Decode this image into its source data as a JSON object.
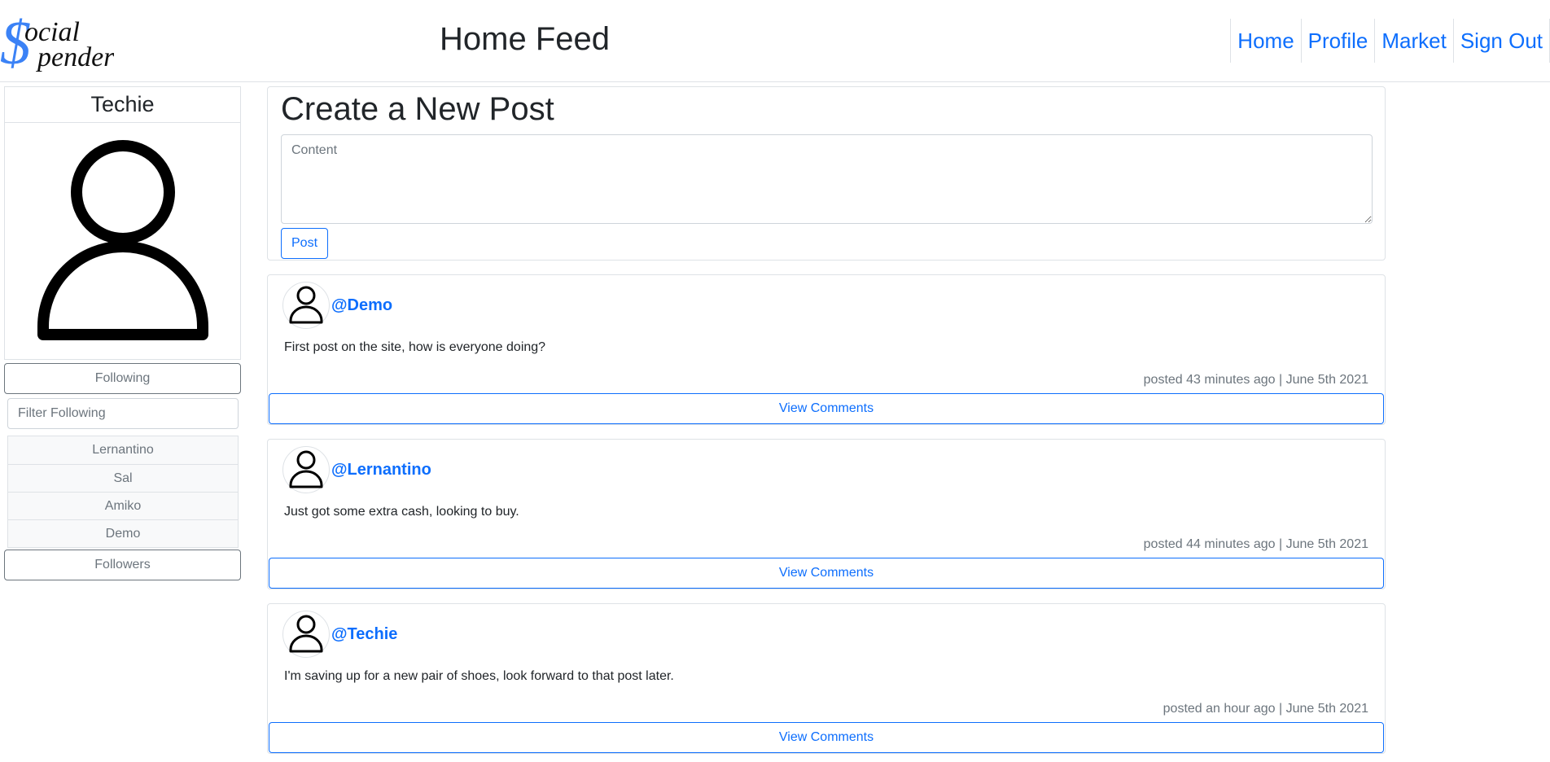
{
  "header": {
    "logo_text": "Social Spenders",
    "logo_line1": "ocial",
    "logo_line2": "penders",
    "title": "Home Feed",
    "nav": [
      "Home",
      "Profile",
      "Market",
      "Sign Out"
    ]
  },
  "sidebar": {
    "username": "Techie",
    "following_label": "Following",
    "filter_placeholder": "Filter Following",
    "following": [
      "Lernantino",
      "Sal",
      "Amiko",
      "Demo"
    ],
    "followers_label": "Followers"
  },
  "create_post": {
    "title": "Create a New Post",
    "content_placeholder": "Content",
    "post_label": "Post"
  },
  "posts": [
    {
      "user": "@Demo",
      "content": "First post on the site, how is everyone doing?",
      "meta": "posted 43 minutes ago | June 5th 2021",
      "view_label": "View Comments"
    },
    {
      "user": "@Lernantino",
      "content": "Just got some extra cash, looking to buy.",
      "meta": "posted 44 minutes ago | June 5th 2021",
      "view_label": "View Comments"
    },
    {
      "user": "@Techie",
      "content": "I'm saving up for a new pair of shoes, look forward to that post later.",
      "meta": "posted an hour ago | June 5th 2021",
      "view_label": "View Comments"
    }
  ],
  "colors": {
    "accent": "#0d6efd",
    "logo": "#3b82f6",
    "muted": "#6c757d",
    "border": "#dee2e6"
  },
  "icons": {
    "logo": "dollar-sign-logo",
    "avatar": "user-icon"
  }
}
